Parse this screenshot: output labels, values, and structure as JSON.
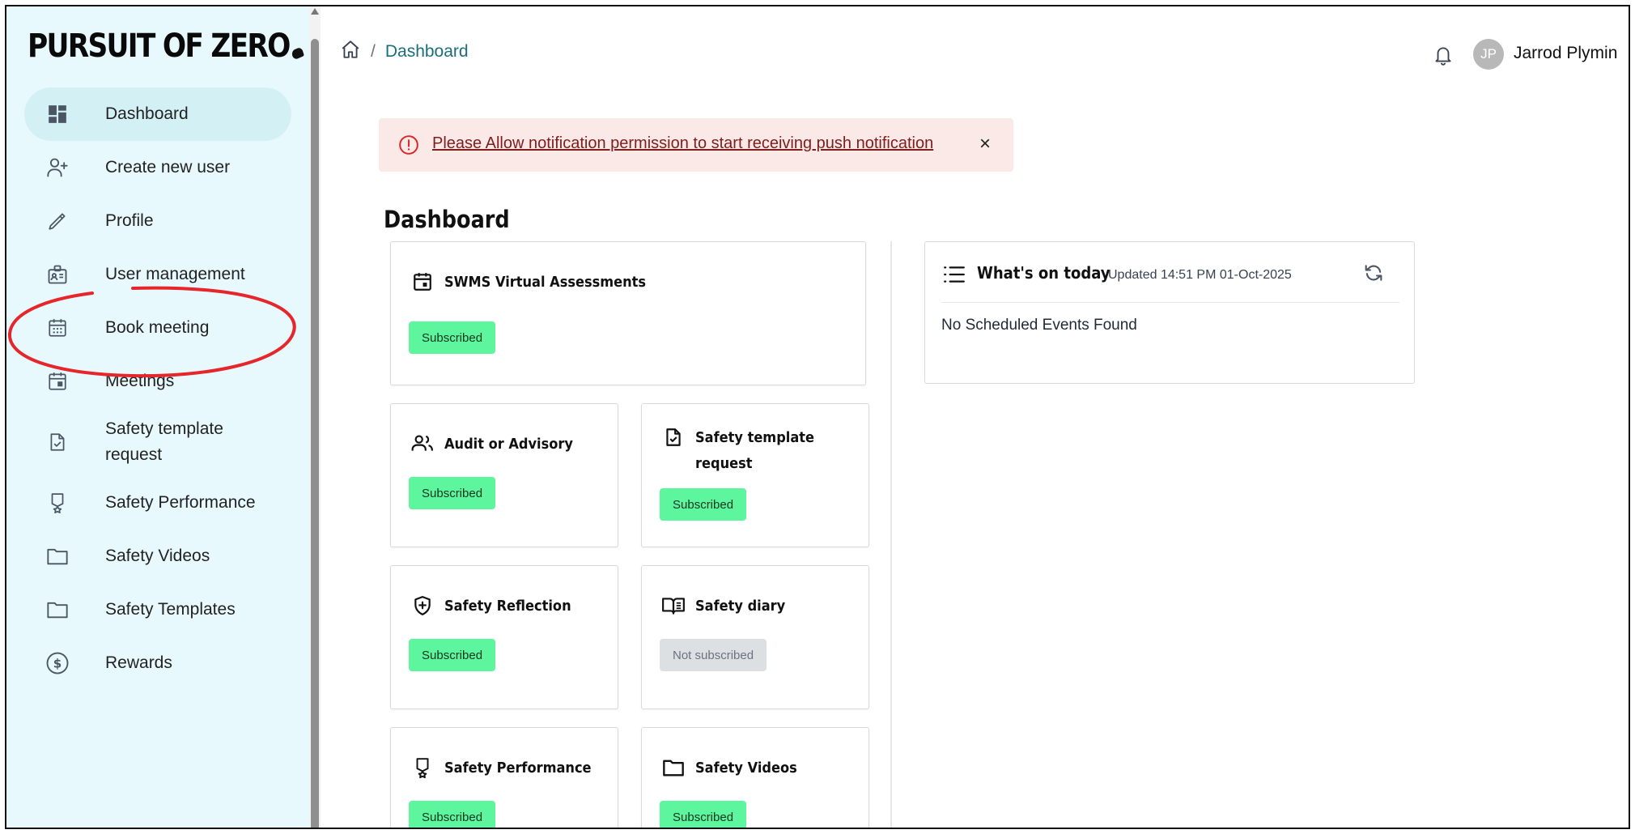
{
  "app": {
    "logo_text": "PURSUIT OF ZERO"
  },
  "sidebar": {
    "items": [
      {
        "label": "Dashboard",
        "icon": "dashboard-icon",
        "active": true
      },
      {
        "label": "Create new user",
        "icon": "add-user-icon"
      },
      {
        "label": "Profile",
        "icon": "pencil-icon"
      },
      {
        "label": "User management",
        "icon": "id-badge-icon"
      },
      {
        "label": "Book meeting",
        "icon": "calendar-grid-icon"
      },
      {
        "label": "Meetings",
        "icon": "calendar-icon"
      },
      {
        "label": "Safety template request",
        "icon": "file-check-icon"
      },
      {
        "label": "Safety Performance",
        "icon": "award-icon"
      },
      {
        "label": "Safety Videos",
        "icon": "folder-icon"
      },
      {
        "label": "Safety Templates",
        "icon": "folder-icon"
      },
      {
        "label": "Rewards",
        "icon": "dollar-circle-icon"
      }
    ]
  },
  "header": {
    "breadcrumb": {
      "current": "Dashboard",
      "separator": "/"
    },
    "user": {
      "initials": "JP",
      "name": "Jarrod Plymin"
    }
  },
  "alert": {
    "text": "Please Allow notification permission to start receiving push notification",
    "close": "×"
  },
  "main": {
    "title": "Dashboard",
    "cards": [
      {
        "title": "SWMS Virtual Assessments",
        "status": "Subscribed",
        "icon": "calendar-icon"
      },
      {
        "title": "Audit or Advisory",
        "status": "Subscribed",
        "icon": "users-icon"
      },
      {
        "title": "Safety template request",
        "status": "Subscribed",
        "icon": "file-check-icon"
      },
      {
        "title": "Safety Reflection",
        "status": "Subscribed",
        "icon": "shield-plus-icon"
      },
      {
        "title": "Safety diary",
        "status": "Not subscribed",
        "icon": "book-icon"
      },
      {
        "title": "Safety Performance",
        "status": "Subscribed",
        "icon": "award-icon"
      },
      {
        "title": "Safety Videos",
        "status": "Subscribed",
        "icon": "folder-icon"
      }
    ]
  },
  "today": {
    "title": "What's on today",
    "updated": "Updated 14:51 PM 01-Oct-2025",
    "empty": "No Scheduled Events Found"
  },
  "colors": {
    "sidebar_bg": "#e8f9fe",
    "active_item": "#d3f1f5",
    "subscribed": "#5ef59f",
    "not_subscribed": "#dde0e3",
    "alert_bg": "#fbe9e7",
    "highlight": "#e5262b",
    "breadcrumb_link": "#1c6d7c"
  }
}
